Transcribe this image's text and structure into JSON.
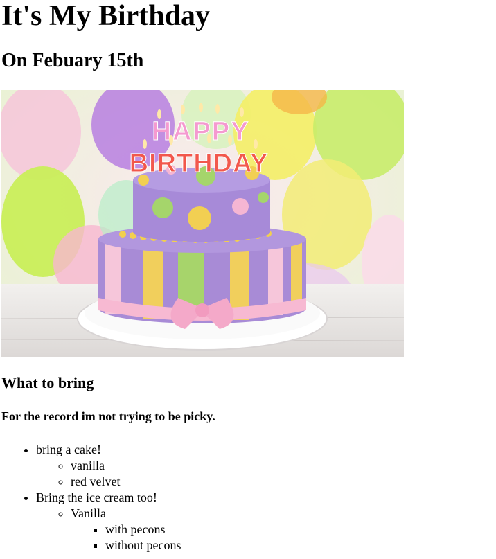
{
  "header": {
    "title": "It's My Birthday",
    "date": "On Febuary 15th"
  },
  "image": {
    "alt": "Birthday cake with HAPPY BIRTHDAY candles",
    "candle_top": "HAPPY",
    "candle_bottom": "BIRTHDAY"
  },
  "bring": {
    "heading": "What to bring",
    "note": "For the record im not trying to be picky.",
    "items": [
      {
        "label": "bring a cake!",
        "sub": [
          "vanilla",
          "red velvet"
        ]
      },
      {
        "label": "Bring the ice cream too!",
        "sub_label": "Vanilla",
        "sub_sub": [
          "with pecons",
          "without pecons"
        ]
      }
    ]
  }
}
